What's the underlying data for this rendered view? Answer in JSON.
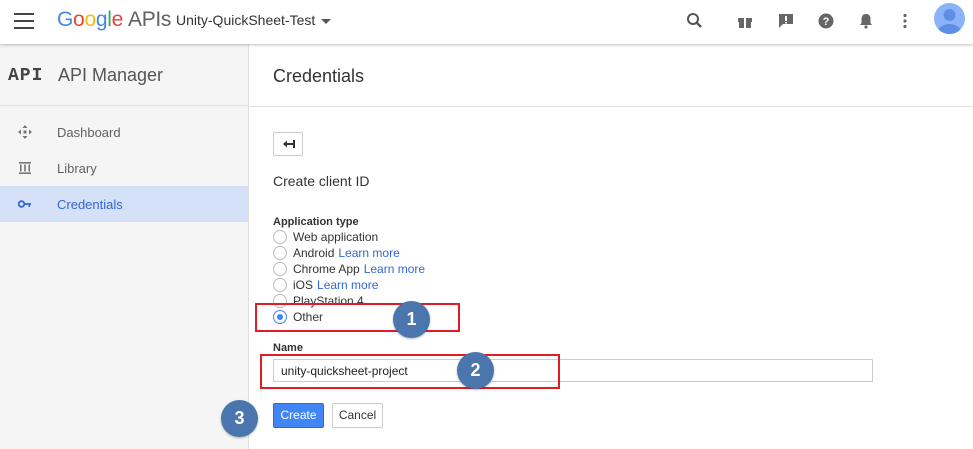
{
  "header": {
    "logo_google": "Google",
    "logo_apis": "APIs",
    "project": "Unity-QuickSheet-Test",
    "colors": {
      "google_blue": "#4285f4",
      "google_red": "#ea4335",
      "google_yellow": "#fbbc05",
      "google_green": "#34a853"
    }
  },
  "sidebar": {
    "mark": "API",
    "title": "API Manager",
    "items": [
      {
        "label": "Dashboard",
        "icon": "dashboard-icon"
      },
      {
        "label": "Library",
        "icon": "library-icon"
      },
      {
        "label": "Credentials",
        "icon": "key-icon",
        "active": true
      }
    ]
  },
  "main": {
    "title": "Credentials",
    "subtitle": "Create client ID",
    "app_type_label": "Application type",
    "options": [
      {
        "label": "Web application",
        "learn": ""
      },
      {
        "label": "Android",
        "learn": "Learn more"
      },
      {
        "label": "Chrome App",
        "learn": "Learn more"
      },
      {
        "label": "iOS",
        "learn": "Learn more"
      },
      {
        "label": "PlayStation 4",
        "learn": ""
      },
      {
        "label": "Other",
        "learn": "",
        "checked": true
      }
    ],
    "name_label": "Name",
    "name_value": "unity-quicksheet-project",
    "create_label": "Create",
    "cancel_label": "Cancel"
  },
  "annotations": {
    "step1": "1",
    "step2": "2",
    "step3": "3"
  }
}
